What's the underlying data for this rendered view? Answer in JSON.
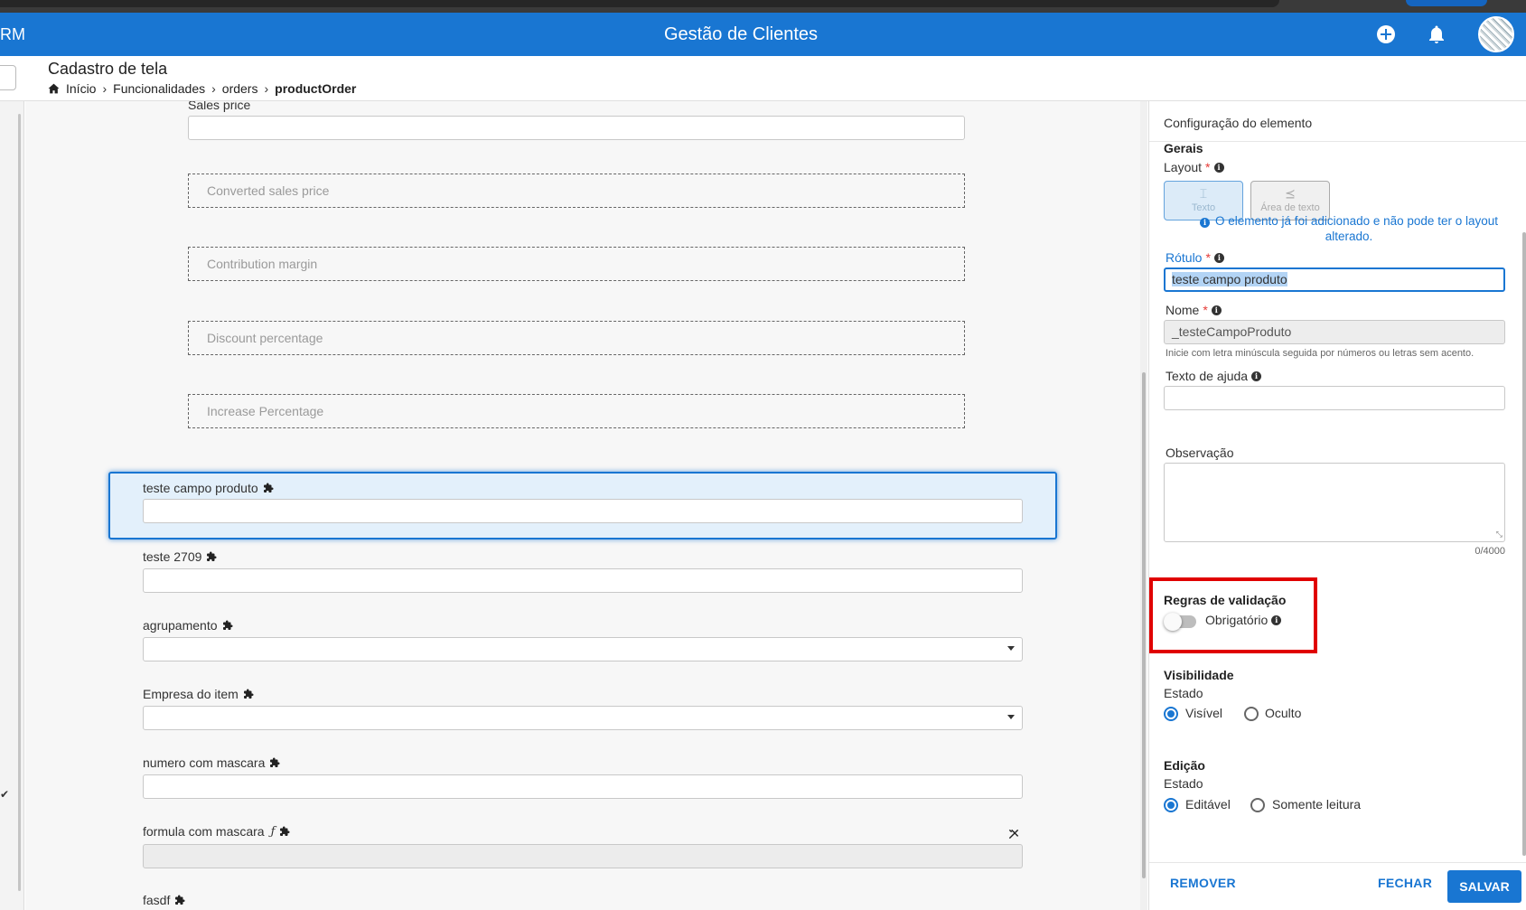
{
  "app": {
    "brand": "RM",
    "title": "Gestão de Clientes"
  },
  "header": {
    "page_title": "Cadastro de tela",
    "breadcrumb": [
      "Início",
      "Funcionalidades",
      "orders",
      "productOrder"
    ]
  },
  "form": {
    "sales_price_label": "Sales price",
    "placeholders": [
      "Converted sales price",
      "Contribution margin",
      "Discount percentage",
      "Increase Percentage"
    ],
    "fields": [
      {
        "label": "teste campo produto",
        "type": "text"
      },
      {
        "label": "teste 2709",
        "type": "text"
      },
      {
        "label": "agrupamento",
        "type": "select"
      },
      {
        "label": "Empresa do item",
        "type": "select"
      },
      {
        "label": "numero com mascara",
        "type": "text"
      },
      {
        "label": "formula com mascara",
        "type": "formula"
      },
      {
        "label": "fasdf",
        "type": "text"
      }
    ]
  },
  "panel": {
    "title": "Configuração do elemento",
    "gerais": "Gerais",
    "layout_label": "Layout",
    "layout_options": [
      "Texto",
      "Área de texto"
    ],
    "layout_notice": "O elemento já foi adicionado e não pode ter o layout alterado.",
    "rotulo_label": "Rótulo",
    "rotulo_value": "teste campo produto",
    "nome_label": "Nome",
    "nome_value": "_testeCampoProduto",
    "nome_hint": "Inicie com letra minúscula seguida por números ou letras sem acento.",
    "ajuda_label": "Texto de ajuda",
    "obs_label": "Observação",
    "obs_counter": "0/4000",
    "validacao_title": "Regras de validação",
    "obrigatorio_label": "Obrigatório",
    "visibilidade_title": "Visibilidade",
    "visibilidade_estado": "Estado",
    "visivel": "Visível",
    "oculto": "Oculto",
    "edicao_title": "Edição",
    "edicao_estado": "Estado",
    "editavel": "Editável",
    "somente_leitura": "Somente leitura",
    "remover": "REMOVER",
    "fechar": "FECHAR",
    "salvar": "SALVAR"
  },
  "colors": {
    "primary": "#1976d2",
    "highlight": "#e00000"
  }
}
